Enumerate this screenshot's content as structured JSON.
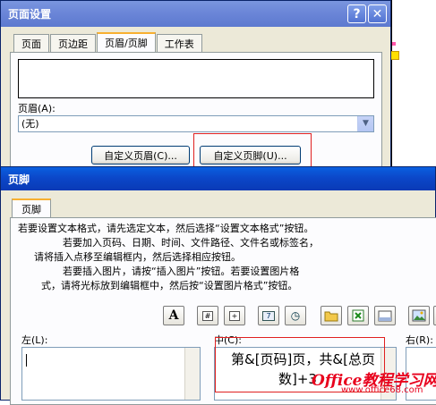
{
  "page_setup": {
    "title": "页面设置",
    "help_glyph": "?",
    "close_glyph": "✕",
    "tabs": [
      "页面",
      "页边距",
      "页眉/页脚",
      "工作表"
    ],
    "header_label": "页眉(A):",
    "header_value": "(无)",
    "custom_header_button": "自定义页眉(C)...",
    "custom_footer_button": "自定义页脚(U)..."
  },
  "footer_dialog": {
    "title": "页脚",
    "tab": "页脚",
    "instructions": [
      "若要设置文本格式，请先选定文本，然后选择“设置文本格式”按钮。",
      "若要加入页码、日期、时间、文件路径、文件名或标签名，",
      "请将插入点移至编辑框内，然后选择相应按钮。",
      "若要插入图片，请按“插入图片”按钮。若要设置图片格",
      "式，请将光标放到编辑框中，然后按“设置图片格式”按钮。"
    ],
    "toolbar": {
      "font_glyph": "A",
      "page_number_glyph": "#",
      "total_pages_glyph": "+",
      "date_glyph": "7",
      "time_glyph": "◷"
    },
    "left_label": "左(L):",
    "center_label": "中(C):",
    "right_label": "右(R):",
    "center_line1": "第&[页码]页，共&[总页",
    "center_line2": "数]+3",
    "watermark_text": "Office教程学习网",
    "watermark_url": "www.office68.com"
  },
  "colors": {
    "title_active": "#0b47c9",
    "title_inactive": "#6b86d8",
    "dialog_bg": "#ece9d8",
    "highlight": "#e02020"
  }
}
